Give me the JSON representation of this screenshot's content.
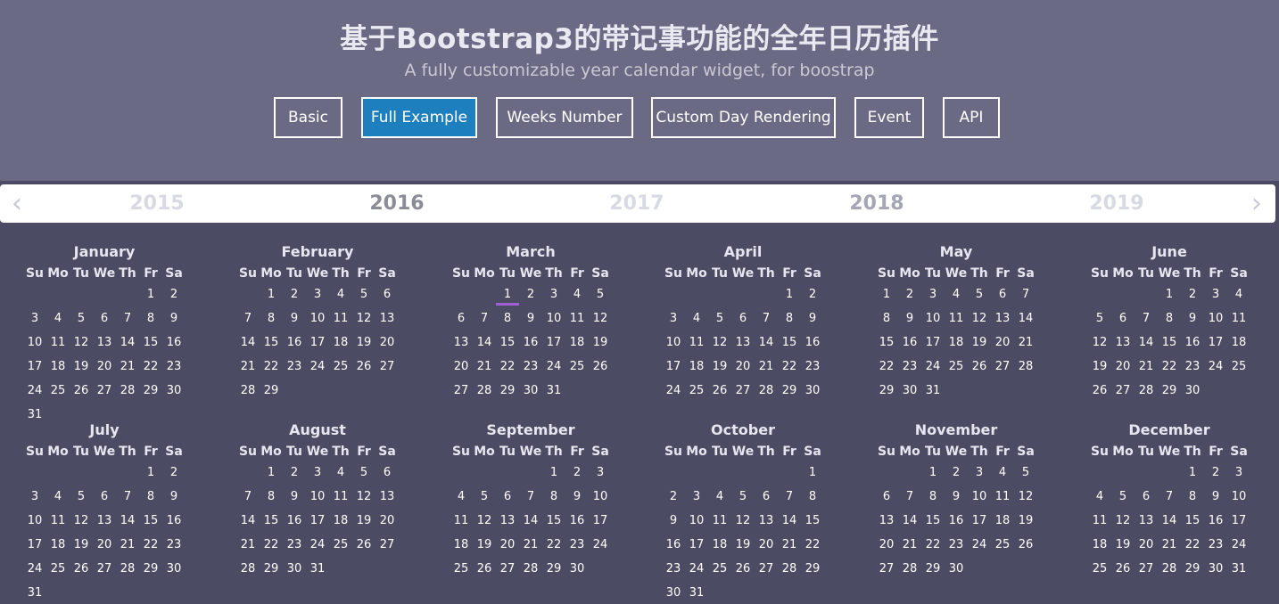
{
  "header": {
    "title": "基于Bootstrap3的带记事功能的全年日历插件",
    "subtitle": "A fully customizable year calendar widget, for boostrap"
  },
  "tabs": [
    {
      "label": "Basic",
      "active": false
    },
    {
      "label": "Full Example",
      "active": true
    },
    {
      "label": "Weeks Number",
      "active": false
    },
    {
      "label": "Custom Day Rendering",
      "active": false
    },
    {
      "label": "Event",
      "active": false
    },
    {
      "label": "API",
      "active": false
    }
  ],
  "yearbar": {
    "prev_icon": "chevron-left-icon",
    "next_icon": "chevron-right-icon",
    "years": [
      "2015",
      "2016",
      "2017",
      "2018",
      "2019"
    ],
    "current": "2016"
  },
  "weekdays": [
    "Su",
    "Mo",
    "Tu",
    "We",
    "Th",
    "Fr",
    "Sa"
  ],
  "colors": {
    "active_tab": "#1e7fbf",
    "event_marker": "#a15fd1",
    "background": "#4b4b63",
    "header": "#6a6a84"
  },
  "months": [
    {
      "name": "January",
      "first_dow": 5,
      "days": 31
    },
    {
      "name": "February",
      "first_dow": 1,
      "days": 29
    },
    {
      "name": "March",
      "first_dow": 2,
      "days": 31,
      "marked": [
        1
      ]
    },
    {
      "name": "April",
      "first_dow": 5,
      "days": 30
    },
    {
      "name": "May",
      "first_dow": 0,
      "days": 31
    },
    {
      "name": "June",
      "first_dow": 3,
      "days": 30
    },
    {
      "name": "July",
      "first_dow": 5,
      "days": 31
    },
    {
      "name": "August",
      "first_dow": 1,
      "days": 31
    },
    {
      "name": "September",
      "first_dow": 4,
      "days": 30
    },
    {
      "name": "October",
      "first_dow": 6,
      "days": 31
    },
    {
      "name": "November",
      "first_dow": 2,
      "days": 30
    },
    {
      "name": "December",
      "first_dow": 4,
      "days": 31
    }
  ]
}
